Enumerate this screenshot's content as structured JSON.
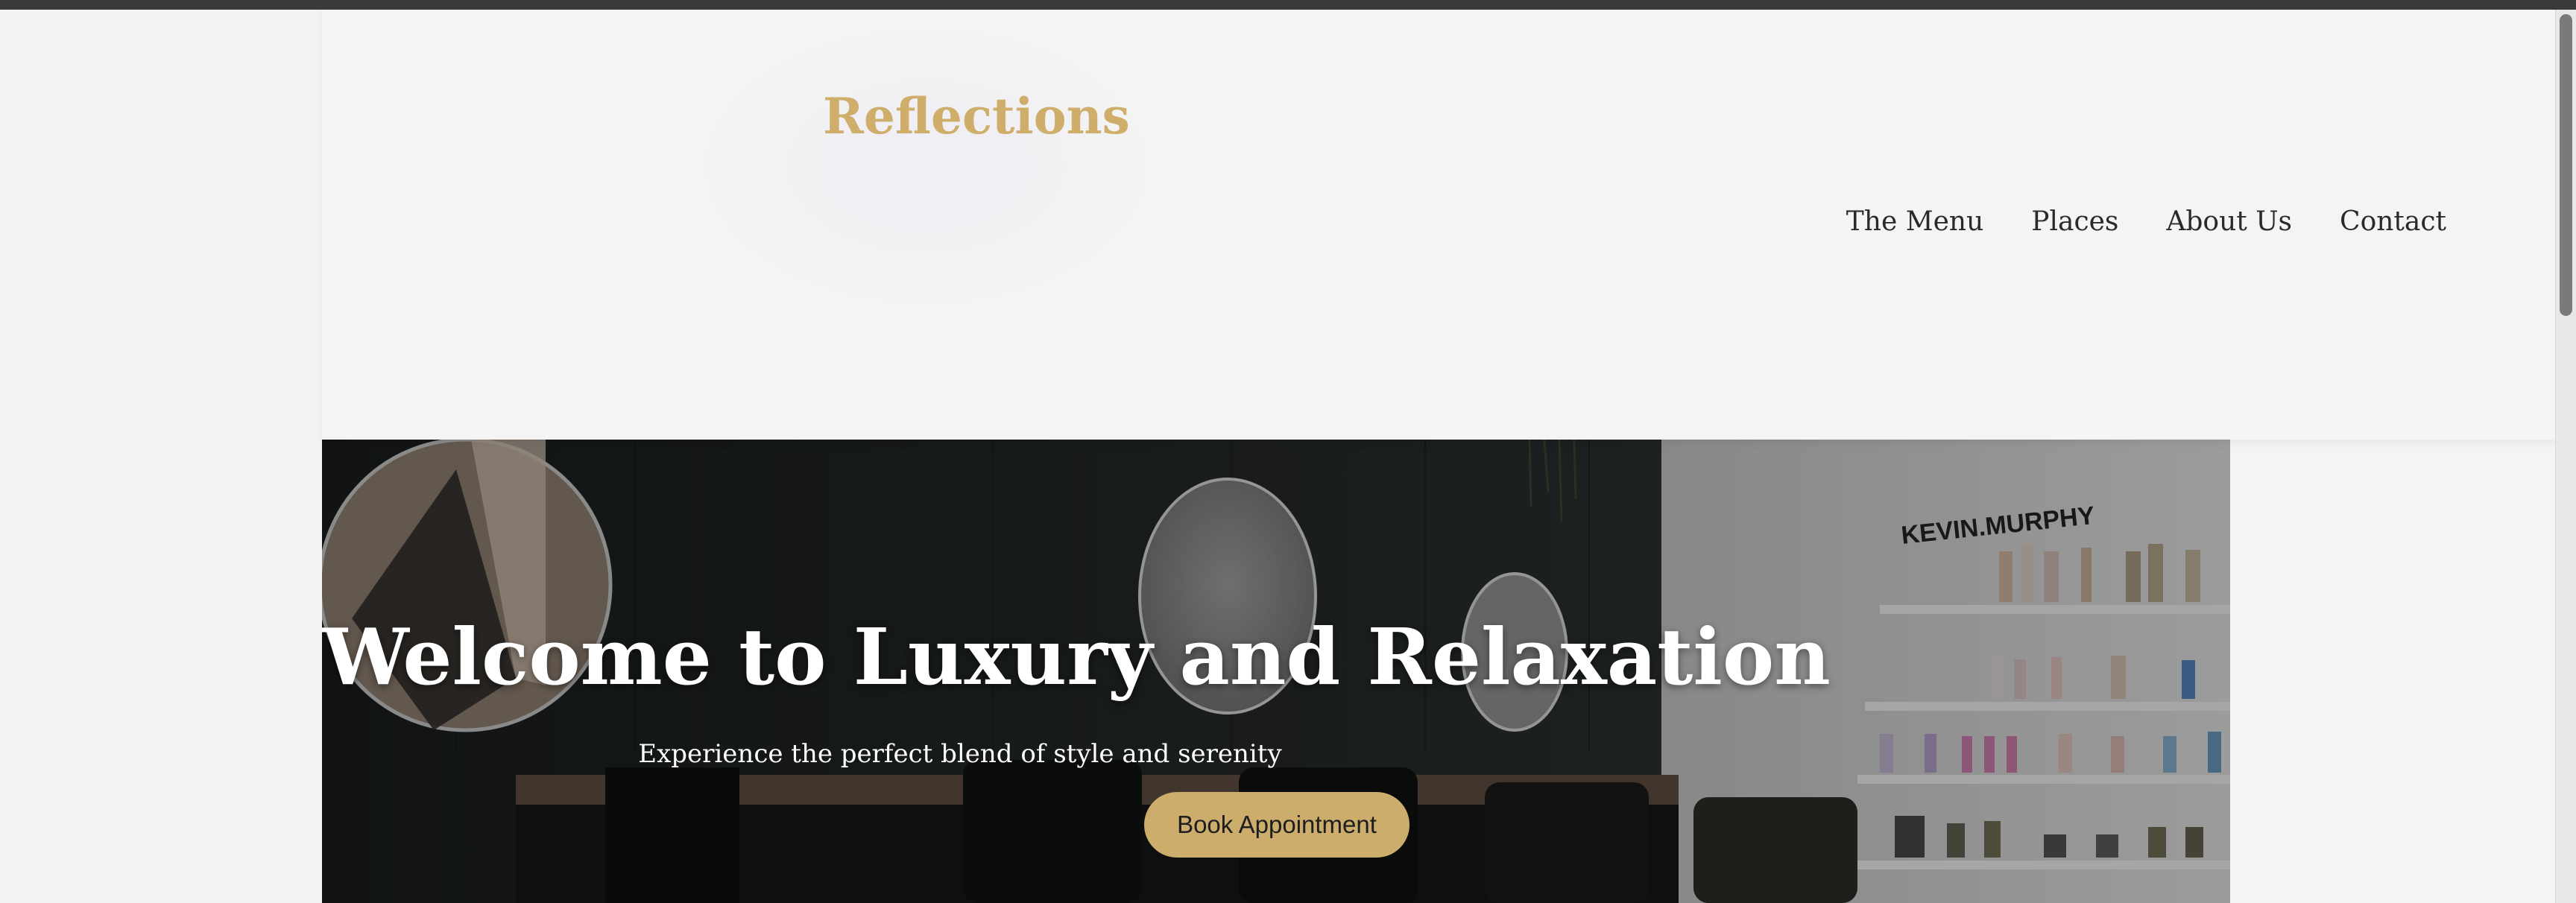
{
  "header": {
    "logo": "Reflections",
    "nav": [
      {
        "label": "The Menu"
      },
      {
        "label": "Places"
      },
      {
        "label": "About Us"
      },
      {
        "label": "Contact"
      }
    ]
  },
  "hero": {
    "title": "Welcome to Luxury and Relaxation",
    "subtitle": "Experience the perfect blend of style and serenity",
    "cta_label": "Book Appointment",
    "shelf_brand": "KEVIN.MURPHY"
  },
  "colors": {
    "accent_gold": "#cfae6c",
    "nav_text": "#2a2a2a",
    "page_bg": "#f3f3f3"
  }
}
